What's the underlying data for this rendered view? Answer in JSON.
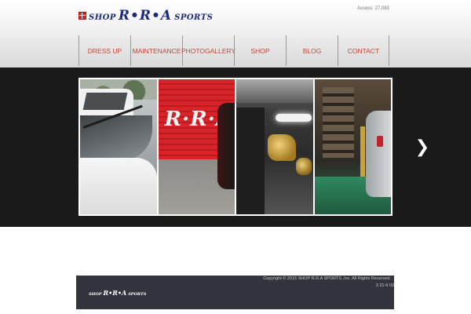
{
  "header": {
    "logo": {
      "prefix": "SHOP",
      "main": "R•R•A",
      "suffix": "SPORTS"
    },
    "access": "Access: 27,083"
  },
  "nav": {
    "items": [
      {
        "label": "DRESS UP"
      },
      {
        "label": "MAINTENANCE"
      },
      {
        "label": "PHOTOGALLERY"
      },
      {
        "label": "SHOP"
      },
      {
        "label": "BLOG"
      },
      {
        "label": "CONTACT"
      }
    ]
  },
  "slider": {
    "photo2_sign": "R·R·A",
    "next_icon": "chevron-right-icon"
  },
  "footer": {
    "logo": {
      "prefix": "SHOP",
      "main": "R•R•A",
      "suffix": "SPORTS"
    },
    "copyright": "Copyright  © 2015 SHOP R.R.A SPORTS ,Inc. All Rights Reserved.",
    "address": "3   21-9     03"
  },
  "colors": {
    "nav_text": "#c4453c",
    "logo_blue": "#1c2c7a",
    "slider_bg": "#1a1a1a",
    "footer_bg": "#34343f"
  }
}
